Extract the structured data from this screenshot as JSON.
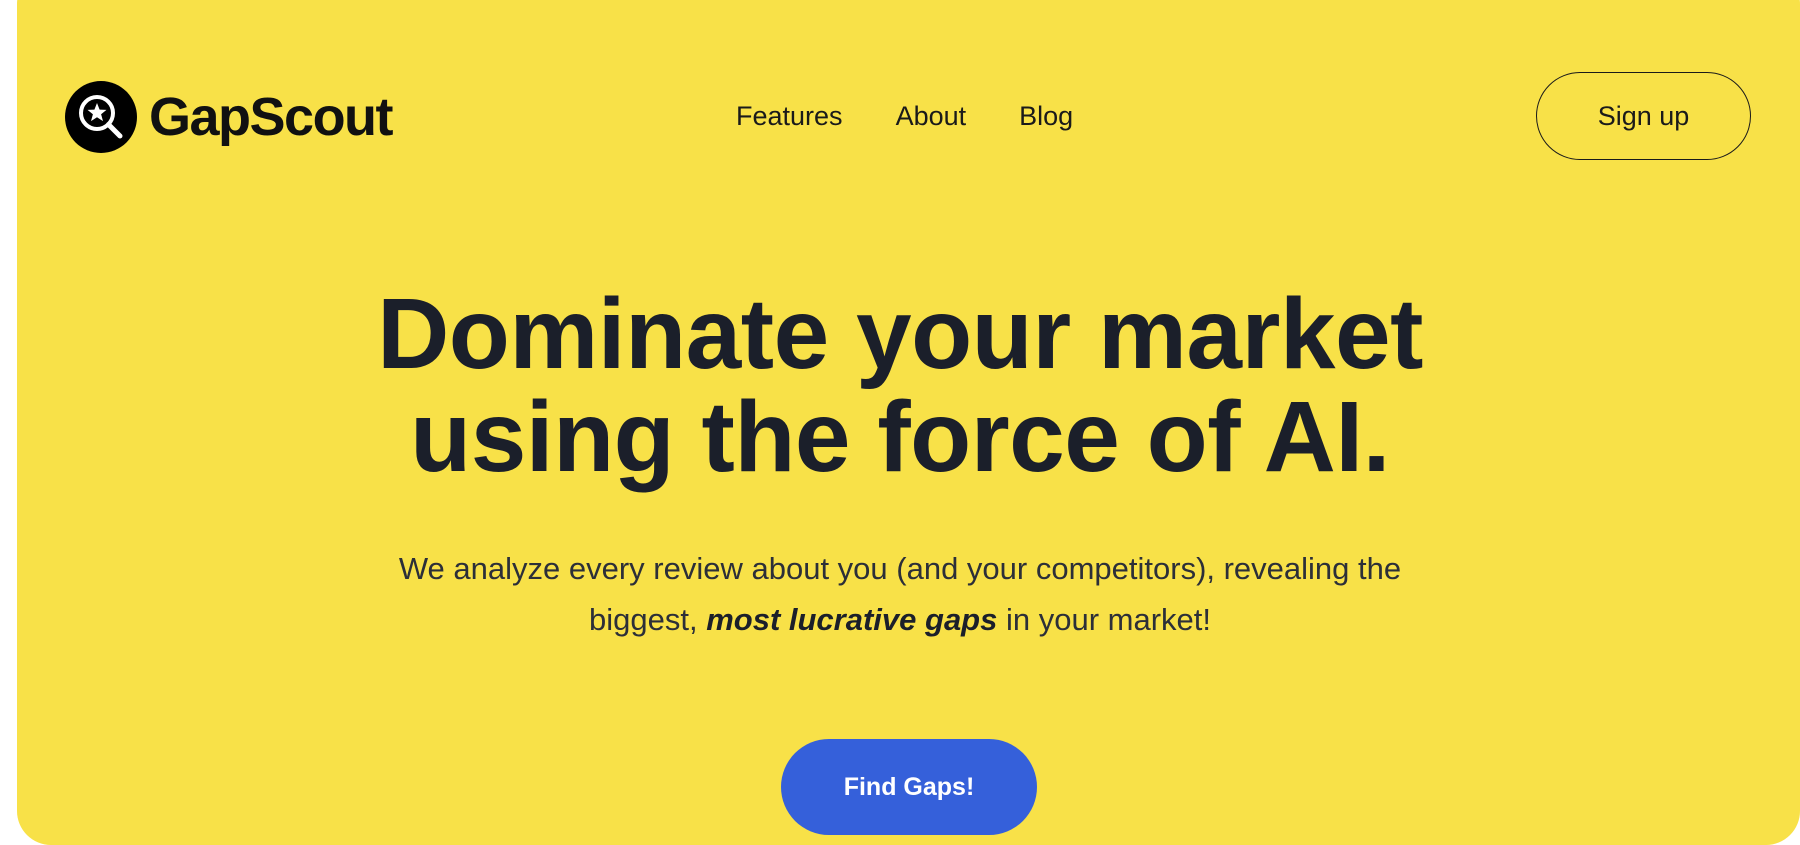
{
  "brand": {
    "name": "GapScout",
    "icon": "magnifier-star-icon"
  },
  "nav": {
    "items": [
      {
        "label": "Features"
      },
      {
        "label": "About"
      },
      {
        "label": "Blog"
      }
    ],
    "signup_label": "Sign up"
  },
  "hero": {
    "headline_line1": "Dominate your market",
    "headline_line2": "using the force of AI.",
    "subtitle_part1": "We analyze every review about you (and your competitors), revealing the",
    "subtitle_part2": "biggest,",
    "subtitle_emphasis": "most lucrative gaps",
    "subtitle_part3": "in your market!",
    "cta_label": "Find Gaps!"
  },
  "colors": {
    "background": "#f8e148",
    "text": "#1b1f2a",
    "accent": "#3560da"
  }
}
